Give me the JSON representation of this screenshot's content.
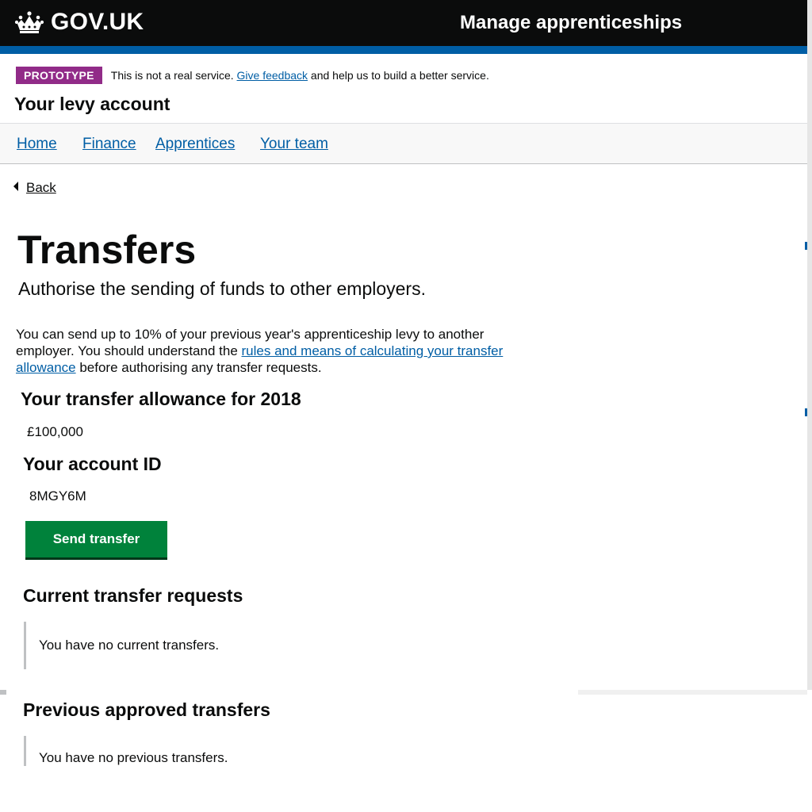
{
  "header": {
    "logo_text": "GOV.UK",
    "service_name": "Manage apprenticeships",
    "background_color": "#0b0c0c",
    "stripe_color": "#005ea5",
    "logo_icon": "crown-icon"
  },
  "phase_banner": {
    "tag": "PROTOTYPE",
    "text_before": "This is not a real service.",
    "link_text": "Give feedback",
    "text_after": "and help us to build a better service.",
    "tag_color": "#912b88"
  },
  "account_title": "Your levy account",
  "nav": {
    "items": [
      {
        "label": "Home"
      },
      {
        "label": "Finance"
      },
      {
        "label": "Apprentices"
      },
      {
        "label": "Your team"
      }
    ]
  },
  "back_link": "Back",
  "page": {
    "title": "Transfers",
    "lede": "Authorise the sending of funds to other employers.",
    "intro_before": "You can send up to 10% of your previous year's apprenticeship levy to another employer. You should understand the",
    "intro_link": "rules and means of calculating your transfer allowance",
    "intro_after": "before authorising any transfer requests."
  },
  "allowance": {
    "heading": "Your transfer allowance for 2018",
    "value": "£100,000"
  },
  "account_id": {
    "heading": "Your account ID",
    "value": "8MGY6M"
  },
  "send_button": {
    "label": "Send transfer",
    "color": "#00823b"
  },
  "current_transfers": {
    "heading": "Current transfer requests",
    "empty_text": "You have no current transfers."
  },
  "previous_transfers": {
    "heading": "Previous approved transfers",
    "empty_text": "You have no previous transfers."
  }
}
